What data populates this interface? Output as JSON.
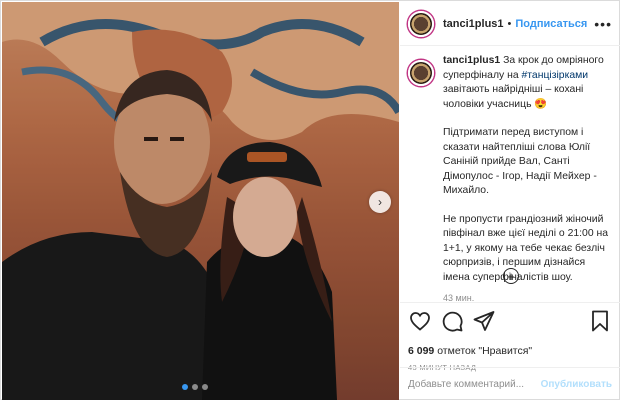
{
  "post": {
    "username": "tanci1plus1",
    "follow_label": "Подписаться",
    "separator": "•",
    "more_label": "•••",
    "caption_username": "tanci1plus1",
    "caption_part1": "За крок до омріяного суперфіналу на",
    "hashtag": "#танцізірками",
    "caption_part2": "завітають найрідніші – кохані чоловіки учасниць 😍",
    "caption_para2": "Підтримати перед виступом і сказати найтепліші слова Юлії Саніній прийде Вал, Санті Дімопулос - Ігор, Надії Мейхер - Михайло.",
    "caption_para3": "Не пропусти грандіозний жіночий півфінал вже цієї неділі о 21:00 на 1+1, у якому на тебе чекає безліч сюрпризів, і першим дізнайся імена суперфіналістів шоу.",
    "caption_time": "43 мин.",
    "load_more": "+"
  },
  "actions": {
    "likes_count": "6 099",
    "likes_text": "отметок \"Нравится\"",
    "posted_time": "43 МИНУТ НАЗАД"
  },
  "comment_box": {
    "placeholder": "Добавьте комментарий...",
    "publish_label": "Опубликовать"
  },
  "carousel": {
    "next_label": "›",
    "total_slides": 3,
    "active_slide": 1
  },
  "colors": {
    "accent": "#3897f0",
    "link": "#00376b",
    "muted": "#8e8e8e",
    "publish_disabled": "#b2dffc"
  }
}
